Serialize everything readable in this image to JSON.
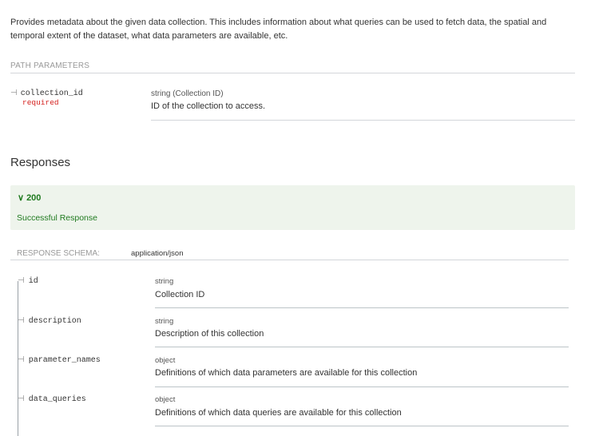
{
  "description": "Provides metadata about the given data collection. This includes information about what queries can be used to fetch data, the spatial and temporal extent of the dataset, what data parameters are available, etc.",
  "path_parameters": {
    "label": "PATH PARAMETERS",
    "items": [
      {
        "name": "collection_id",
        "required": "required",
        "type": "string (Collection ID)",
        "description": "ID of the collection to access."
      }
    ]
  },
  "responses": {
    "title": "Responses",
    "code": "200",
    "code_text": "Successful Response",
    "schema_label": "RESPONSE SCHEMA:",
    "schema_type": "application/json",
    "properties": [
      {
        "name": "id",
        "type": "string",
        "description": "Collection ID"
      },
      {
        "name": "description",
        "type": "string",
        "description": "Description of this collection"
      },
      {
        "name": "parameter_names",
        "type": "object",
        "description": "Definitions of which data parameters are available for this collection"
      },
      {
        "name": "data_queries",
        "type": "object",
        "description": "Definitions of which data queries are available for this collection"
      }
    ]
  },
  "icons": {
    "tick": "⊣",
    "chevron": "∨"
  },
  "colors": {
    "success": "#1f7a1f",
    "success_bg": "#eef4ec",
    "required": "#d41f1c"
  }
}
